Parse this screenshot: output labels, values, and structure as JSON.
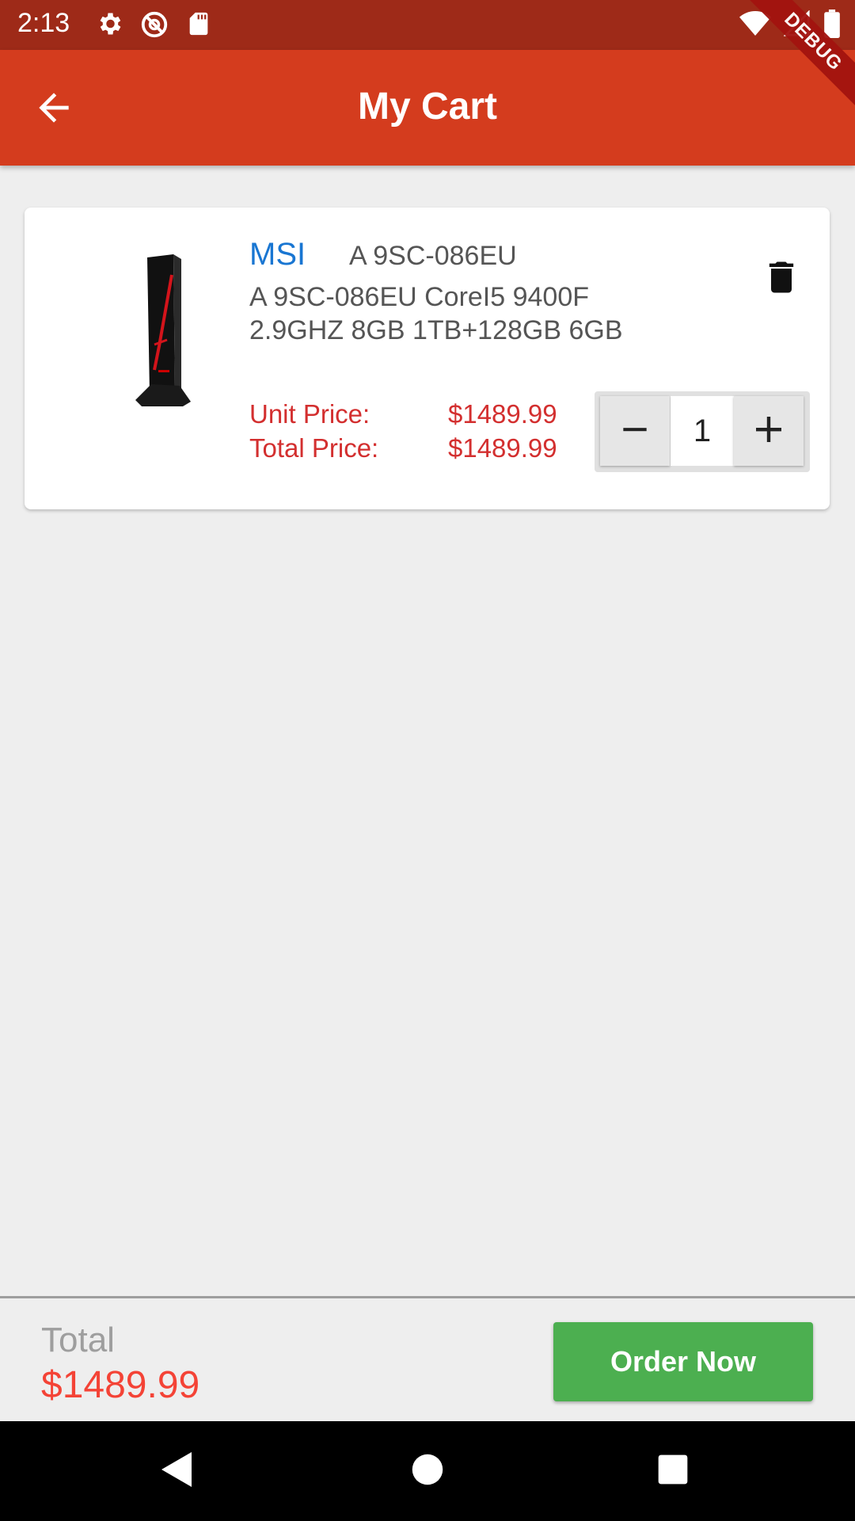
{
  "status_bar": {
    "time": "2:13",
    "icons_left": [
      "settings-icon",
      "sync-icon",
      "sd-card-icon"
    ],
    "icons_right": [
      "wifi-icon",
      "cell-signal-icon",
      "battery-icon"
    ],
    "debug_label": "DEBUG"
  },
  "app_bar": {
    "title": "My Cart",
    "back_icon": "arrow-back-icon",
    "color": "#d43c1e"
  },
  "cart": {
    "items": [
      {
        "brand": "MSI",
        "model": "A 9SC-086EU",
        "description": "A 9SC-086EU CoreI5 9400F 2.9GHZ 8GB 1TB+128GB 6GB",
        "unit_price_label": "Unit Price:",
        "unit_price": "$1489.99",
        "total_price_label": "Total Price:",
        "total_price": "$1489.99",
        "quantity": "1",
        "delete_icon": "trash-icon"
      }
    ]
  },
  "footer": {
    "total_label": "Total",
    "total_value": "$1489.99",
    "order_button": "Order Now",
    "order_button_color": "#4caf50"
  },
  "nav_bar": {
    "icons": [
      "back-triangle-icon",
      "home-circle-icon",
      "recents-square-icon"
    ]
  }
}
